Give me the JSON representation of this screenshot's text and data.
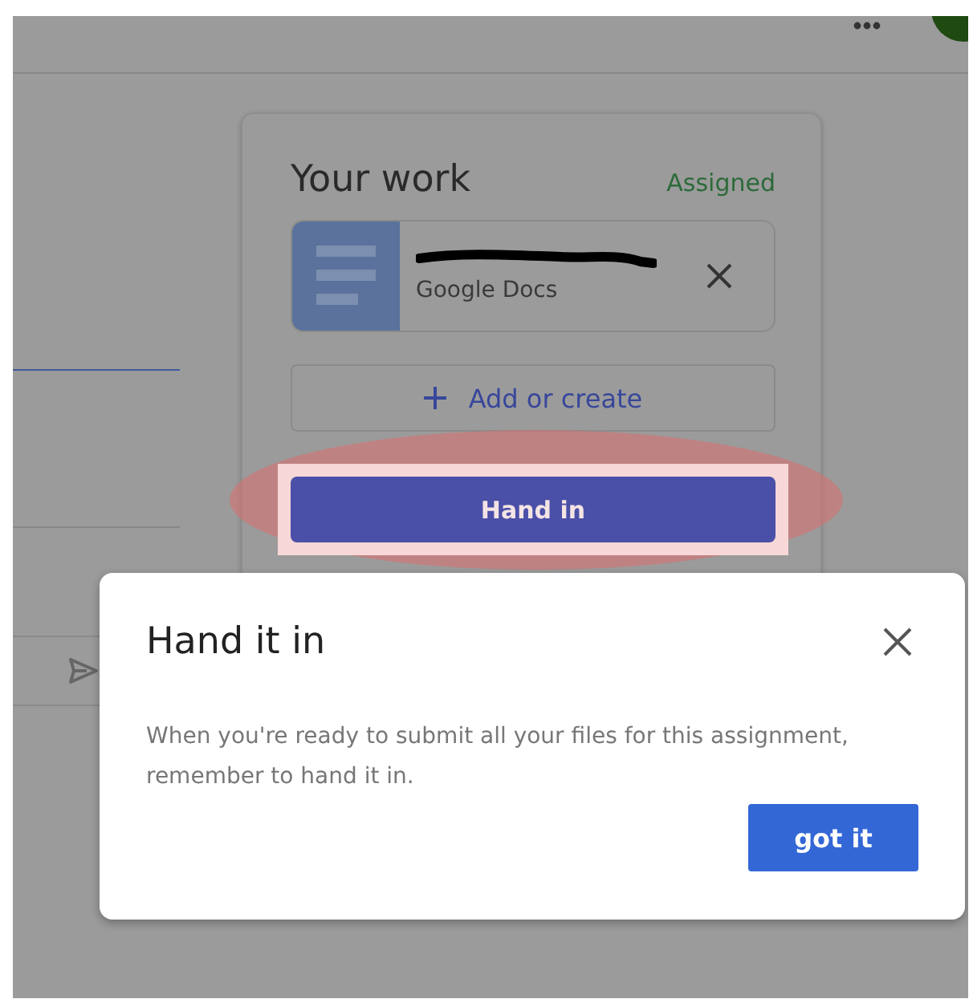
{
  "your_work": {
    "title": "Your work",
    "status": "Assigned",
    "attachment": {
      "type": "Google Docs"
    },
    "add_button": "Add or create",
    "hand_in_button": "Hand in"
  },
  "dialog": {
    "title": "Hand it in",
    "message": "When you're ready to submit all your files for this assignment, remember to hand it in.",
    "button": "got it"
  }
}
